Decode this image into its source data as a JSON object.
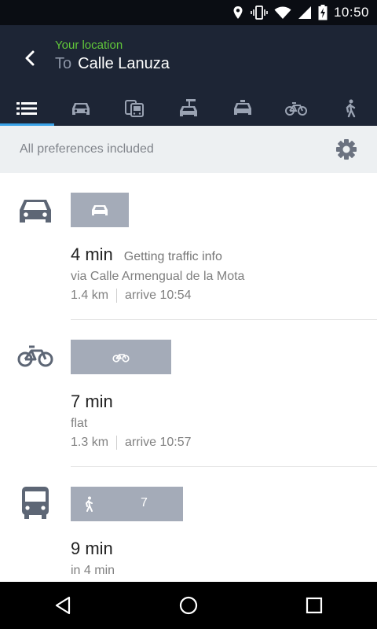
{
  "status_bar": {
    "time": "10:50"
  },
  "header": {
    "from": "Your location",
    "to_prefix": "To",
    "destination": "Calle Lanuza"
  },
  "tabs": [
    {
      "icon": "list-icon",
      "active": true
    },
    {
      "icon": "car-icon",
      "active": false
    },
    {
      "icon": "transit-icon",
      "active": false
    },
    {
      "icon": "car-rental-icon",
      "active": false
    },
    {
      "icon": "taxi-icon",
      "active": false
    },
    {
      "icon": "bike-icon",
      "active": false
    },
    {
      "icon": "walk-icon",
      "active": false
    }
  ],
  "preferences": {
    "label": "All preferences included"
  },
  "routes": [
    {
      "mode_icon": "car-icon",
      "pill_icon": "car-icon",
      "duration": "4 min",
      "note": "Getting traffic info",
      "via": "via Calle Armengual de la Mota",
      "distance": "1.4 km",
      "arrive": "arrive 10:54"
    },
    {
      "mode_icon": "bike-icon",
      "pill_icon": "bike-icon",
      "duration": "7 min",
      "note": "",
      "via": "flat",
      "distance": "1.3 km",
      "arrive": "arrive 10:57"
    },
    {
      "mode_icon": "bus-icon",
      "pill_icon": "walk-icon",
      "pill_text": "7",
      "duration": "9 min",
      "note": "",
      "via": "in 4 min"
    }
  ],
  "colors": {
    "header_bg": "#1d2535",
    "accent_green": "#61c73a",
    "tab_indicator": "#3aa3e8",
    "pill_bg": "#a4abb8"
  }
}
